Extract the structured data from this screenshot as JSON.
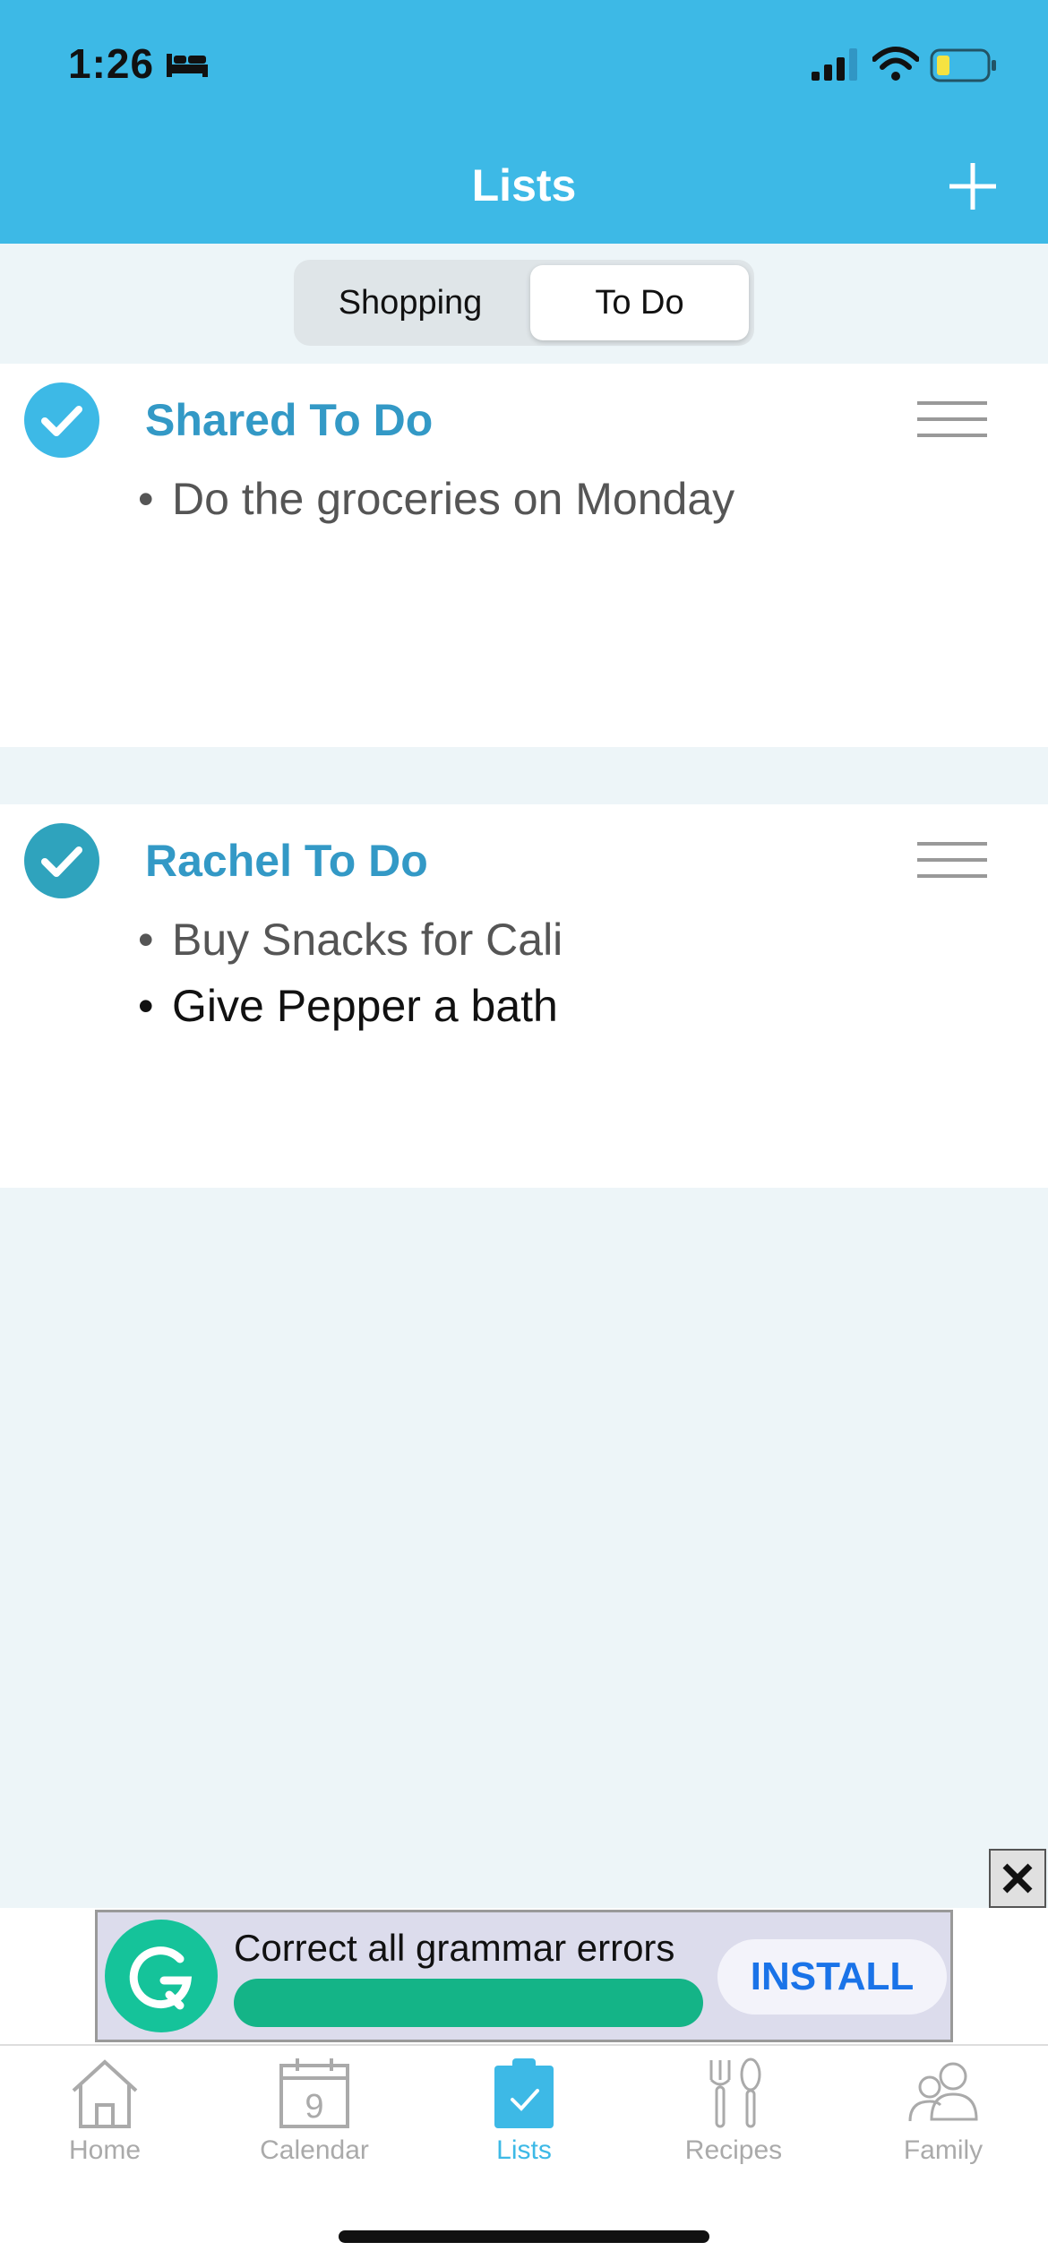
{
  "status_bar": {
    "time": "1:26"
  },
  "header": {
    "title": "Lists",
    "add_icon": "plus-icon"
  },
  "segments": {
    "shopping": "Shopping",
    "todo": "To Do",
    "selected": "To Do"
  },
  "lists": [
    {
      "title": "Shared To Do",
      "items": [
        "Do the groceries on Monday"
      ]
    },
    {
      "title": "Rachel To Do",
      "items": [
        "Buy Snacks for Cali",
        "Give Pepper a bath"
      ]
    }
  ],
  "ad": {
    "text": "Correct all grammar errors",
    "button": "INSTALL",
    "close_icon": "close-icon"
  },
  "tabs": [
    {
      "label": "Home",
      "icon": "home-icon"
    },
    {
      "label": "Calendar",
      "icon": "calendar-icon",
      "calendar_day": "9"
    },
    {
      "label": "Lists",
      "icon": "clipboard-check-icon"
    },
    {
      "label": "Recipes",
      "icon": "fork-spoon-icon"
    },
    {
      "label": "Family",
      "icon": "family-icon"
    }
  ],
  "colors": {
    "header": "#3db9e6",
    "list_title": "#3399c6",
    "active_tab": "#3db9e6",
    "ad_bar": "#14b487",
    "install": "#1a73e8"
  }
}
